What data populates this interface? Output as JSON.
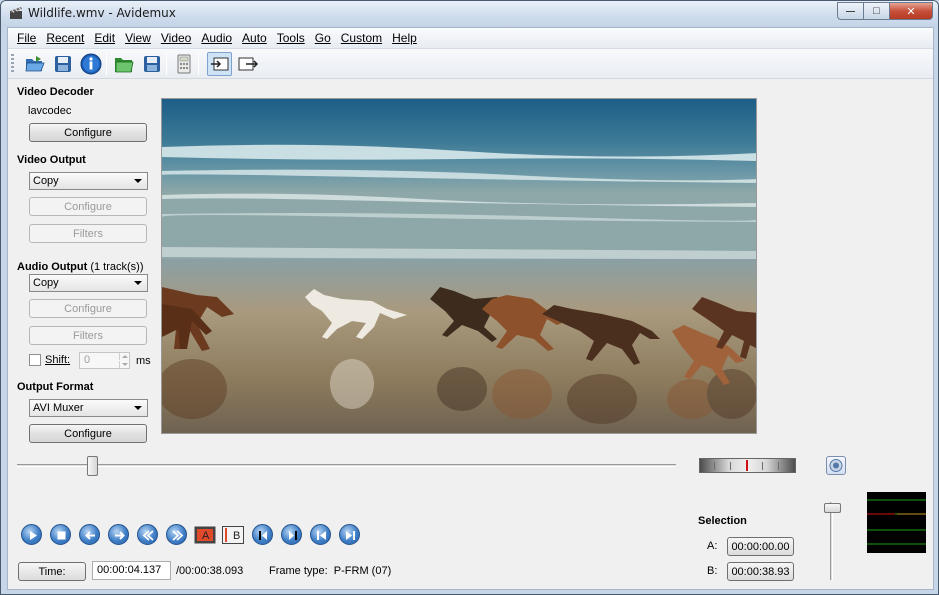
{
  "window": {
    "title": "Wildlife.wmv - Avidemux",
    "minimize": "—",
    "maximize": "□",
    "close": "✕"
  },
  "menu": [
    "File",
    "Recent",
    "Edit",
    "View",
    "Video",
    "Audio",
    "Auto",
    "Tools",
    "Go",
    "Custom",
    "Help"
  ],
  "toolbar": {
    "icons": [
      "open-icon",
      "save-icon",
      "info-icon",
      "open-folder-icon",
      "save-video-icon",
      "calculator-icon",
      "input-preview-icon",
      "output-preview-icon"
    ]
  },
  "video_decoder": {
    "title": "Video Decoder",
    "codec": "lavcodec",
    "configure": "Configure"
  },
  "video_output": {
    "title": "Video Output",
    "selected": "Copy",
    "configure": "Configure",
    "filters": "Filters"
  },
  "audio_output": {
    "title": "Audio Output",
    "tracks": "(1 track(s))",
    "selected": "Copy",
    "configure": "Configure",
    "filters": "Filters",
    "shift_label": "Shift:",
    "shift_value": "0",
    "shift_unit": "ms"
  },
  "output_format": {
    "title": "Output Format",
    "selected": "AVI Muxer",
    "configure": "Configure"
  },
  "playback": {
    "position_fraction": 0.115,
    "time_button": "Time:",
    "current_time": "00:00:04.137",
    "total_time": "/00:00:38.093",
    "frame_type": "Frame type:  P-FRM (07)"
  },
  "selection": {
    "title": "Selection",
    "a_label": "A:",
    "a_value": "00:00:00.00",
    "b_label": "B:",
    "b_value": "00:00:38.93"
  },
  "nav_buttons": [
    "play-icon",
    "stop-icon",
    "previous-frame-icon",
    "next-frame-icon",
    "previous-keyframe-icon",
    "next-keyframe-icon",
    "set-marker-a-icon",
    "set-marker-b-icon",
    "go-marker-a-icon",
    "go-marker-b-icon",
    "go-first-frame-icon",
    "go-last-frame-icon"
  ],
  "ab_labels": {
    "a": "A",
    "b": "B"
  }
}
